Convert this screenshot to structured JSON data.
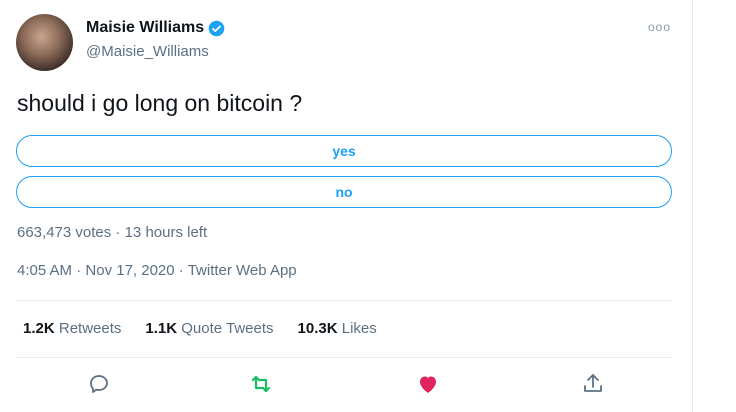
{
  "author": {
    "name": "Maisie Williams",
    "handle": "@Maisie_Williams"
  },
  "more_label": "ooo",
  "tweet": {
    "text": "should i go long on bitcoin ?"
  },
  "poll": {
    "options": [
      "yes",
      "no"
    ],
    "votes": "663,473 votes",
    "separator": "·",
    "time_left": "13 hours left"
  },
  "meta": {
    "time": "4:05 AM",
    "date": "Nov 17, 2020",
    "source": "Twitter Web App",
    "separator": "·"
  },
  "stats": {
    "retweets_count": "1.2K",
    "retweets_label": "Retweets",
    "quotes_count": "1.1K",
    "quotes_label": "Quote Tweets",
    "likes_count": "10.3K",
    "likes_label": "Likes"
  },
  "colors": {
    "accent": "#1da1f2",
    "retweet_green": "#17bf63",
    "like_red": "#e0245e"
  },
  "icons": [
    "verified-badge-icon",
    "reply-icon",
    "retweet-icon",
    "like-icon",
    "share-icon"
  ]
}
